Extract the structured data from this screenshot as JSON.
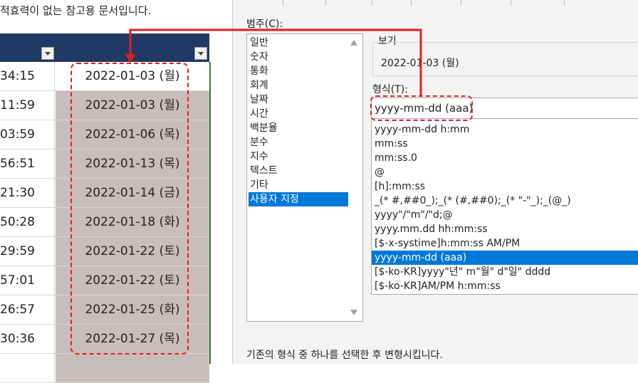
{
  "sheet": {
    "notice": "적효력이 없는 참고용 문서입니다.",
    "rows": [
      {
        "time": "34:15",
        "date": "2022-01-03 (월)"
      },
      {
        "time": "11:59",
        "date": "2022-01-03 (월)"
      },
      {
        "time": "03:59",
        "date": "2022-01-06 (목)"
      },
      {
        "time": "56:51",
        "date": "2022-01-13 (목)"
      },
      {
        "time": "21:30",
        "date": "2022-01-14 (금)"
      },
      {
        "time": "50:28",
        "date": "2022-01-18 (화)"
      },
      {
        "time": "29:59",
        "date": "2022-01-22 (토)"
      },
      {
        "time": "57:01",
        "date": "2022-01-22 (토)"
      },
      {
        "time": "26:57",
        "date": "2022-01-25 (화)"
      },
      {
        "time": "30:36",
        "date": "2022-01-27 (목)"
      }
    ]
  },
  "dialog": {
    "category_label": "범주(C):",
    "categories": [
      "일반",
      "숫자",
      "통화",
      "회계",
      "날짜",
      "시간",
      "백분율",
      "분수",
      "지수",
      "텍스트",
      "기타",
      "사용자 지정"
    ],
    "sample_label": "보기",
    "sample_value": "2022-01-03 (월)",
    "type_label": "형식(T):",
    "type_value": "yyyy-mm-dd (aaa)",
    "formats": [
      "yyyy-mm-dd h:mm",
      "mm:ss",
      "mm:ss.0",
      "@",
      "[h]:mm:ss",
      "_(* #,##0_);_(* (#,##0);_(* \"-\"_);_(@_)",
      "yyyy\"/\"m\"/\"d;@",
      "yyyy.mm.dd hh:mm:ss",
      "[$-x-systime]h:mm:ss AM/PM",
      "yyyy-mm-dd (aaa)",
      "[$-ko-KR]yyyy\"년\" m\"월\" d\"일\" dddd",
      "[$-ko-KR]AM/PM h:mm:ss"
    ],
    "description": "기존의 형식 중 하나를 선택한 후 변형시킵니다."
  },
  "colors": {
    "header": "#1f3864",
    "selection": "#0078d7",
    "highlight": "#e02020",
    "date_fill": "#c9bdbb"
  }
}
